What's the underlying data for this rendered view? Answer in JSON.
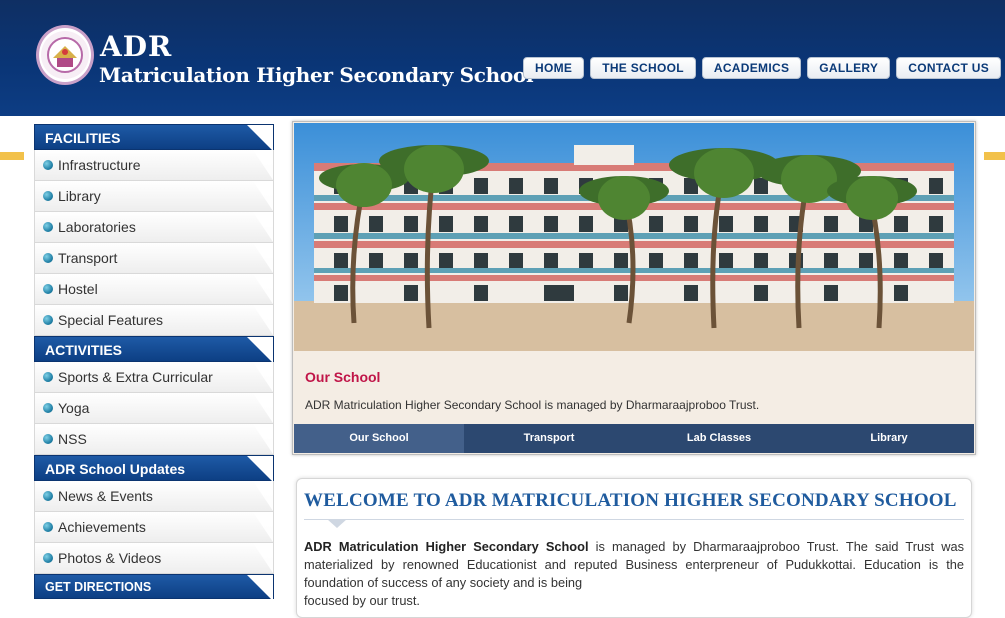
{
  "header": {
    "brand_short": "ADR",
    "brand_full": "Matriculation Higher Secondary School",
    "nav": [
      "HOME",
      "THE SCHOOL",
      "ACADEMICS",
      "GALLERY",
      "CONTACT US"
    ]
  },
  "sidebar": {
    "facilities": {
      "title": "FACILITIES",
      "items": [
        "Infrastructure",
        "Library",
        "Laboratories",
        "Transport",
        "Hostel",
        "Special Features"
      ]
    },
    "activities": {
      "title": "ACTIVITIES",
      "items": [
        "Sports & Extra Curricular",
        "Yoga",
        "NSS"
      ]
    },
    "updates": {
      "title": "ADR School Updates",
      "items": [
        "News & Events",
        "Achievements",
        "Photos & Videos"
      ]
    },
    "directions": {
      "title": "GET DIRECTIONS"
    }
  },
  "slider": {
    "caption_title": "Our School",
    "caption_text": "ADR Matriculation Higher Secondary School is managed by Dharmaraajproboo Trust.",
    "tabs": [
      "Our School",
      "Transport",
      "Lab Classes",
      "Library"
    ],
    "active_tab": "Our School"
  },
  "welcome": {
    "title": "WELCOME TO ADR MATRICULATION HIGHER SECONDARY SCHOOL",
    "lead": "ADR Matriculation Higher Secondary School",
    "body": " is managed by Dharmaraajproboo Trust. The said Trust was materialized by renowned Educationist and reputed Business enterpreneur of Pudukkottai. Education is the foundation of success of any society and is being",
    "body2": "focused by our trust."
  },
  "colors": {
    "header_navy": "#0a3576",
    "gold_strip": "#f2c14a",
    "caption_red": "#c01548",
    "welcome_blue": "#1f5b9e"
  }
}
